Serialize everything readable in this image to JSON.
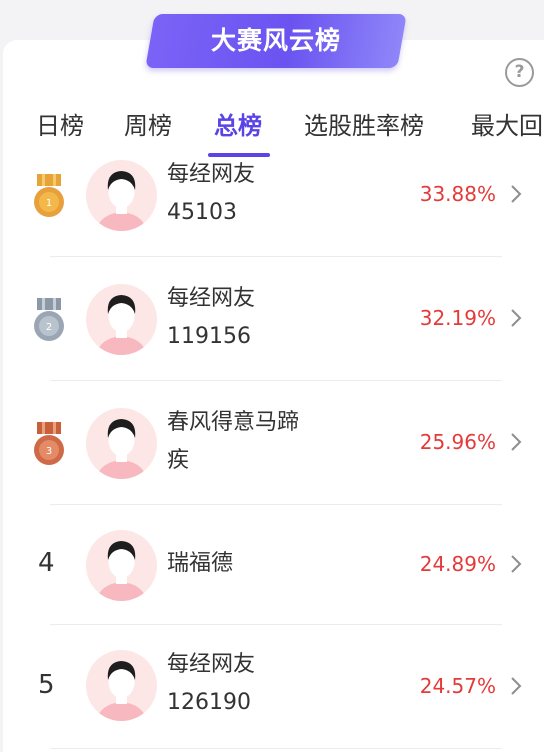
{
  "header": {
    "banner_title": "大赛风云榜",
    "help_glyph": "?"
  },
  "tabs": [
    {
      "label": "日榜",
      "active": false
    },
    {
      "label": "周榜",
      "active": false
    },
    {
      "label": "总榜",
      "active": true
    },
    {
      "label": "选股胜率榜",
      "active": false
    },
    {
      "label": "最大回",
      "active": false
    }
  ],
  "ranking": [
    {
      "rank": "1",
      "badge": "gold-medal-icon",
      "name_line1": "每经网友",
      "name_line2": "45103",
      "rate": "33.88%"
    },
    {
      "rank": "2",
      "badge": "silver-medal-icon",
      "name_line1": "每经网友",
      "name_line2": "119156",
      "rate": "32.19%"
    },
    {
      "rank": "3",
      "badge": "bronze-medal-icon",
      "name_line1": "春风得意马蹄",
      "name_line2": "疾",
      "rate": "25.96%"
    },
    {
      "rank": "4",
      "badge": null,
      "name_line1": "瑞福德",
      "name_line2": "",
      "rate": "24.89%"
    },
    {
      "rank": "5",
      "badge": null,
      "name_line1": "每经网友",
      "name_line2": "126190",
      "rate": "24.57%"
    }
  ],
  "colors": {
    "accent": "#5a44e8",
    "rate_red": "#e43a3a",
    "avatar_bg": "#fde6e6"
  }
}
